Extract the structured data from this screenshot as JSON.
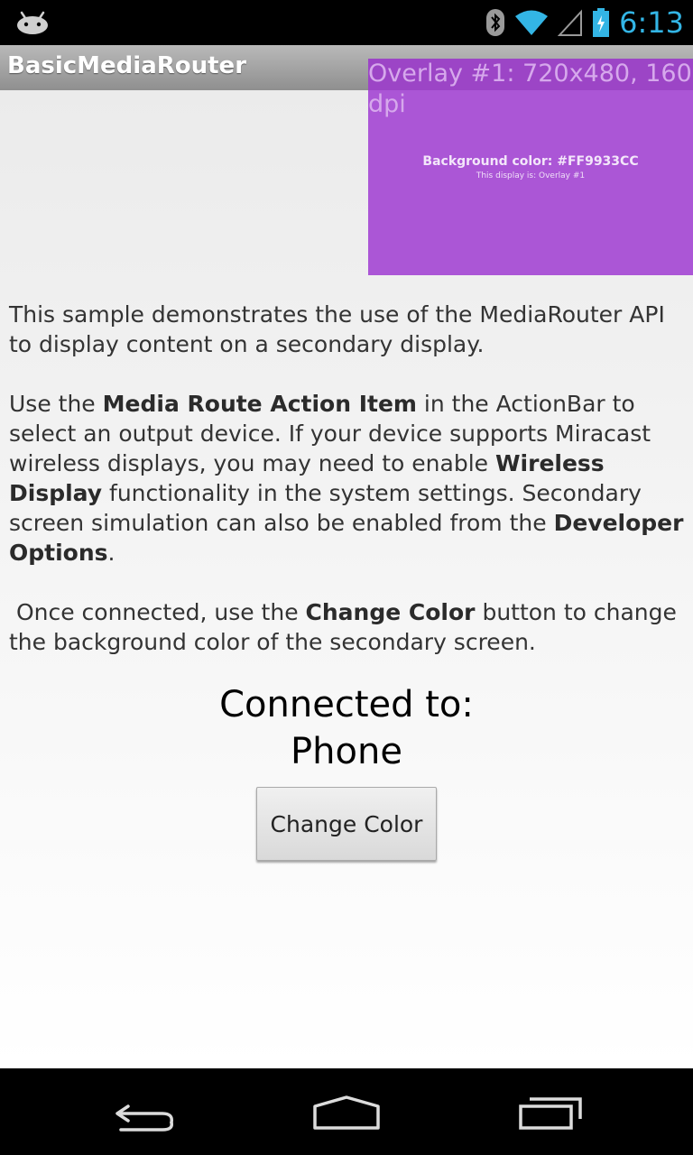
{
  "status_bar": {
    "time": "6:13",
    "icons": [
      "android-notification-icon",
      "bluetooth-icon",
      "wifi-icon",
      "cell-signal-icon",
      "battery-charging-icon"
    ]
  },
  "action_bar": {
    "title": "BasicMediaRouter"
  },
  "overlay": {
    "header": "Overlay #1: 720x480, 160 dpi",
    "background_text": "Background color: #FF9933CC",
    "display_text": "This display is: Overlay #1",
    "color": "#ab56d6"
  },
  "description": {
    "p1": "This sample demonstrates the use of the MediaRouter API to display content on a secondary display.",
    "p2": {
      "t1": "Use the ",
      "b1": "Media Route Action Item",
      "t2": " in the ActionBar to select an output device. If your device supports Miracast wireless displays, you may need to enable ",
      "b2": "Wireless Display",
      "t3": " functionality in the system settings. Secondary screen simulation can also be enabled from the ",
      "b3": "Developer Options",
      "t4": "."
    },
    "p3": {
      "t1": " Once connected, use the ",
      "b1": "Change Color",
      "t2": " button to change the background color of the secondary screen."
    }
  },
  "connection": {
    "label": "Connected to:",
    "device": "Phone"
  },
  "buttons": {
    "change_color": "Change Color"
  },
  "nav_bar": {
    "icons": [
      "back-icon",
      "home-icon",
      "recents-icon"
    ]
  },
  "colors": {
    "accent": "#33b5e5",
    "overlay": "#ab56d6"
  }
}
